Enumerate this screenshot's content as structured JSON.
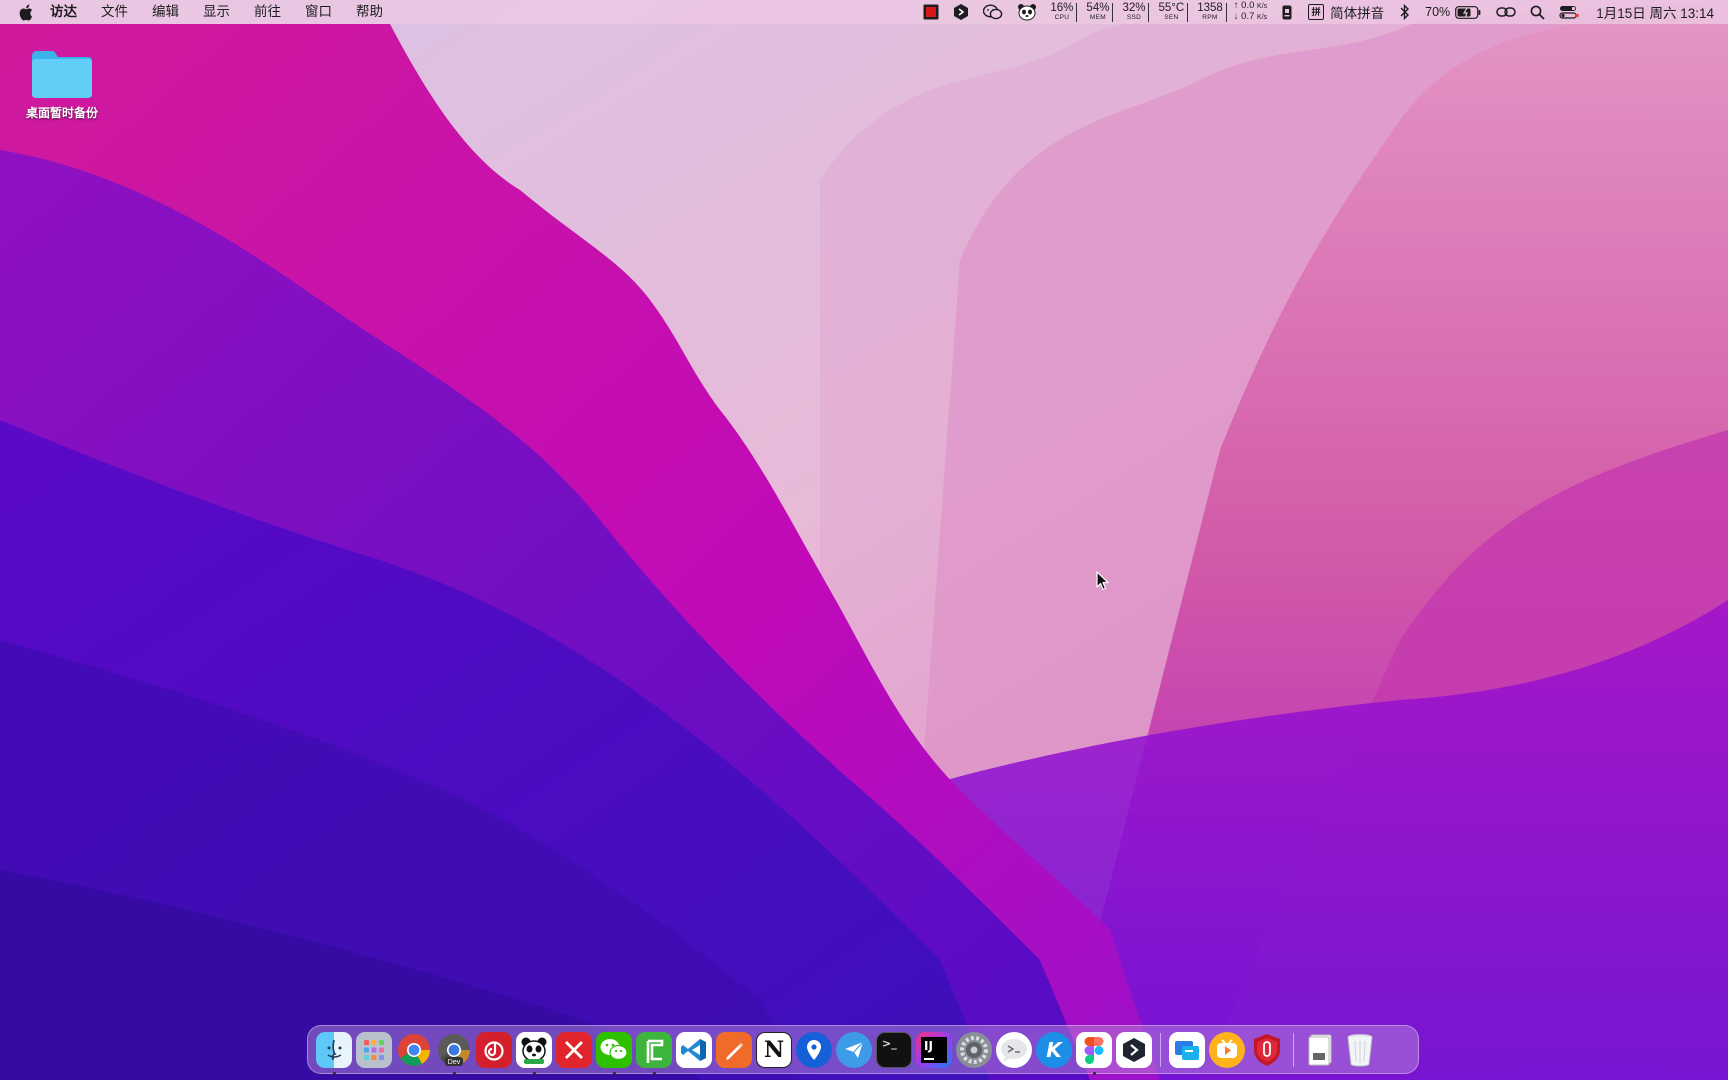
{
  "menubar": {
    "app_name": "访达",
    "menus": [
      "文件",
      "编辑",
      "显示",
      "前往",
      "窗口",
      "帮助"
    ],
    "stats": [
      {
        "value": "16%",
        "label": "CPU"
      },
      {
        "value": "54%",
        "label": "MEM"
      },
      {
        "value": "32%",
        "label": "SSD"
      },
      {
        "value": "55°C",
        "label": "SEN"
      },
      {
        "value": "1358",
        "label": "RPM"
      }
    ],
    "network": {
      "up": "↑ 0.0",
      "down": "↓ 0.7",
      "unit": "K/s"
    },
    "input_method": {
      "glyph": "拼",
      "label": "简体拼音"
    },
    "battery_percent": "70%",
    "clock": "1月15日 周六  13:14",
    "status_icons": [
      "stop-record-icon",
      "app-diamond-icon",
      "wechat-icon",
      "panda-icon",
      "badge-icon",
      "bluetooth-icon",
      "link-icon",
      "spotlight-icon",
      "control-center-icon"
    ]
  },
  "desktop": {
    "items": [
      {
        "label": "桌面暂时备份",
        "icon": "folder-icon"
      }
    ]
  },
  "dock": {
    "apps": [
      {
        "name": "finder",
        "icon": "finder-icon",
        "running": true
      },
      {
        "name": "launchpad",
        "icon": "launchpad-icon",
        "running": false
      },
      {
        "name": "chrome",
        "icon": "chrome-icon",
        "running": false
      },
      {
        "name": "chrome-dev",
        "icon": "chrome-dev-icon",
        "badge": "Dev",
        "running": true
      },
      {
        "name": "netease-music",
        "icon": "music-icon",
        "running": false
      },
      {
        "name": "panda",
        "icon": "panda-icon",
        "running": true
      },
      {
        "name": "x-app",
        "icon": "x-icon",
        "running": false
      },
      {
        "name": "wechat",
        "icon": "wechat-icon",
        "running": true
      },
      {
        "name": "camtasia",
        "icon": "camtasia-icon",
        "running": true
      },
      {
        "name": "vscode",
        "icon": "vscode-icon",
        "running": false
      },
      {
        "name": "pen-app",
        "icon": "pen-icon",
        "running": false
      },
      {
        "name": "notion",
        "icon": "notion-icon",
        "glyph": "N",
        "running": false
      },
      {
        "name": "map-app",
        "icon": "location-pin-icon",
        "running": false
      },
      {
        "name": "paper-plane",
        "icon": "paper-plane-icon",
        "running": false
      },
      {
        "name": "terminal",
        "icon": "terminal-icon",
        "glyph": ">_",
        "running": false
      },
      {
        "name": "intellij",
        "icon": "intellij-icon",
        "glyph": "IJ",
        "running": false
      },
      {
        "name": "system-preferences",
        "icon": "gear-icon",
        "running": false
      },
      {
        "name": "messages",
        "icon": "chat-bubble-icon",
        "running": false
      },
      {
        "name": "kuaiyu",
        "icon": "k-app-icon",
        "glyph": "K",
        "running": false
      },
      {
        "name": "figma",
        "icon": "figma-icon",
        "running": true
      },
      {
        "name": "diamond-app",
        "icon": "diamond-icon",
        "running": false
      }
    ],
    "extras": [
      {
        "name": "translate",
        "icon": "window-blue-icon",
        "running": false
      },
      {
        "name": "video",
        "icon": "play-orange-icon",
        "running": false
      },
      {
        "name": "security",
        "icon": "shield-icon",
        "running": false
      }
    ],
    "stack": [
      {
        "name": "documents",
        "icon": "document-stack-icon"
      },
      {
        "name": "trash",
        "icon": "trash-icon"
      }
    ]
  },
  "colors": {
    "menubar_bg": "#ecc8e2",
    "wallpaper_light": "#e6c9e0",
    "wallpaper_magenta": "#c01ab0",
    "wallpaper_purple": "#5a10c8"
  }
}
